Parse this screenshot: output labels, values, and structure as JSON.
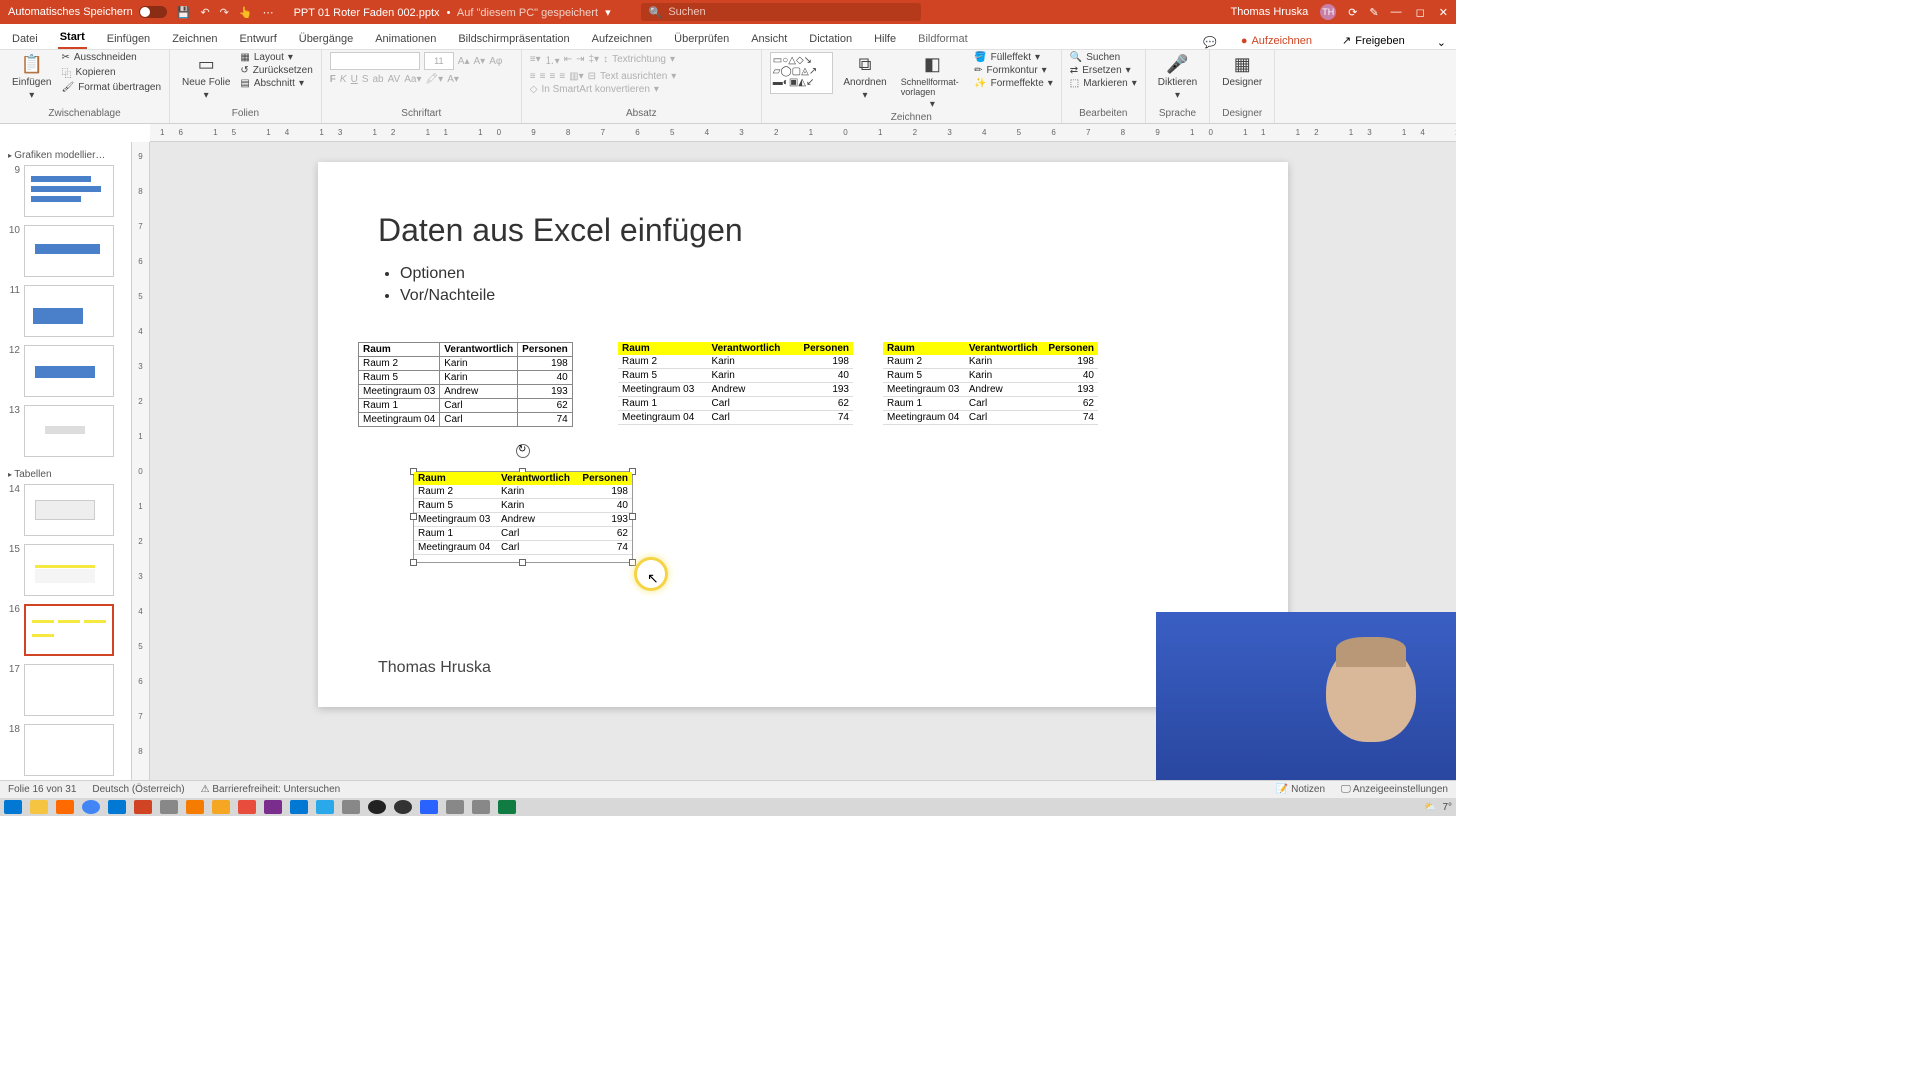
{
  "titlebar": {
    "autosave": "Automatisches Speichern",
    "filename": "PPT 01 Roter Faden 002.pptx",
    "saved_hint": "Auf \"diesem PC\" gespeichert",
    "search_placeholder": "Suchen",
    "user": "Thomas Hruska",
    "user_initials": "TH"
  },
  "tabs": {
    "items": [
      "Datei",
      "Start",
      "Einfügen",
      "Zeichnen",
      "Entwurf",
      "Übergänge",
      "Animationen",
      "Bildschirmpräsentation",
      "Aufzeichnen",
      "Überprüfen",
      "Ansicht",
      "Dictation",
      "Hilfe",
      "Bildformat"
    ],
    "active_index": 1,
    "record": "Aufzeichnen",
    "share": "Freigeben"
  },
  "ribbon": {
    "paste": "Einfügen",
    "cut": "Ausschneiden",
    "copy": "Kopieren",
    "format_painter": "Format übertragen",
    "clipboard": "Zwischenablage",
    "new_slide": "Neue Folie",
    "layout": "Layout",
    "reset": "Zurücksetzen",
    "section": "Abschnitt",
    "slides": "Folien",
    "font_size_hint": "11",
    "font": "Schriftart",
    "paragraph": "Absatz",
    "text_direction": "Textrichtung",
    "align_text": "Text ausrichten",
    "smartart": "In SmartArt konvertieren",
    "drawing": "Zeichnen",
    "arrange": "Anordnen",
    "quickstyles": "Schnellformat-vorlagen",
    "shape_fill": "Fülleffekt",
    "shape_outline": "Formkontur",
    "shape_effects": "Formeffekte",
    "find": "Suchen",
    "replace": "Ersetzen",
    "select": "Markieren",
    "editing": "Bearbeiten",
    "dictate": "Diktieren",
    "voice": "Sprache",
    "designer": "Designer",
    "designer_group": "Designer"
  },
  "thumbrail": {
    "section1": "Grafiken modellier…",
    "section2": "Tabellen",
    "numbers": [
      "9",
      "10",
      "11",
      "12",
      "13",
      "14",
      "15",
      "16",
      "17",
      "18"
    ],
    "active_index": 7
  },
  "slide": {
    "title": "Daten aus Excel einfügen",
    "bullets": [
      "Optionen",
      "Vor/Nachteile"
    ],
    "footer": "Thomas Hruska",
    "table_headers": [
      "Raum",
      "Verantwortlich",
      "Personen"
    ],
    "table_rows": [
      {
        "raum": "Raum 2",
        "ver": "Karin",
        "per": "198"
      },
      {
        "raum": "Raum 5",
        "ver": "Karin",
        "per": "40"
      },
      {
        "raum": "Meetingraum 03",
        "ver": "Andrew",
        "per": "193"
      },
      {
        "raum": "Raum 1",
        "ver": "Carl",
        "per": "62"
      },
      {
        "raum": "Meetingraum 04",
        "ver": "Carl",
        "per": "74"
      }
    ]
  },
  "statusbar": {
    "slide_count": "Folie 16 von 31",
    "language": "Deutsch (Österreich)",
    "accessibility": "Barrierefreiheit: Untersuchen",
    "notes": "Notizen",
    "display": "Anzeigeeinstellungen"
  },
  "taskbar": {
    "temp": "7°"
  }
}
